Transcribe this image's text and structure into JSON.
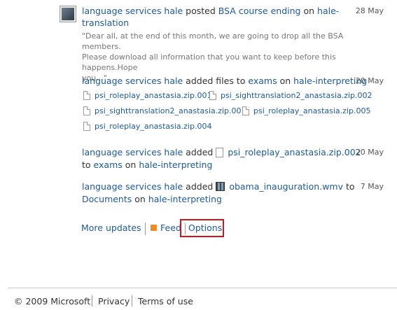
{
  "entries": [
    {
      "user": "language services hale",
      "action": "posted",
      "object": "BSA course ending",
      "preposition": "on",
      "place_line1": "hale-",
      "place_line2": "translation",
      "date": "28 May",
      "quote_line1": "\"Dear all, at the end of this month, we are going to drop all the BSA members.",
      "quote_line2": "Please download all information that you want to keep before this happens.Hope",
      "quote_line3": "you...\""
    },
    {
      "user": "language services hale",
      "action": "added files to",
      "folder": "exams",
      "preposition": "on",
      "place": "hale-interpreting",
      "date": "20 May",
      "files": [
        "psi_roleplay_anastasia.zip.001",
        "psi_sighttranslation2_anastasia.zip.002",
        "psi_sighttranslation2_anastasia.zip.001",
        "psi_roleplay_anastasia.zip.005",
        "psi_roleplay_anastasia.zip.004"
      ]
    },
    {
      "user": "language services hale",
      "action": "added",
      "file": "psi_roleplay_anastasia.zip.002",
      "to": "to",
      "folder": "exams",
      "preposition": "on",
      "place": "hale-interpreting",
      "date": "20 May"
    },
    {
      "user": "language services hale",
      "action": "added",
      "file": "obama_inauguration.wmv",
      "to": "to",
      "folder": "Documents",
      "preposition": "on",
      "place": "hale-interpreting",
      "date": "7 May"
    }
  ],
  "actions": {
    "more_updates": "More updates",
    "feed": "Feed",
    "options": "Options"
  },
  "footer": {
    "copyright": "© 2009 Microsoft",
    "privacy": "Privacy",
    "terms": "Terms of use"
  },
  "colors": {
    "link": "#1e5a96",
    "highlight": "#d0161c",
    "rss": "#f08a24"
  },
  "icons": [
    "user-avatar-icon",
    "file-icon",
    "video-file-icon",
    "rss-icon"
  ]
}
